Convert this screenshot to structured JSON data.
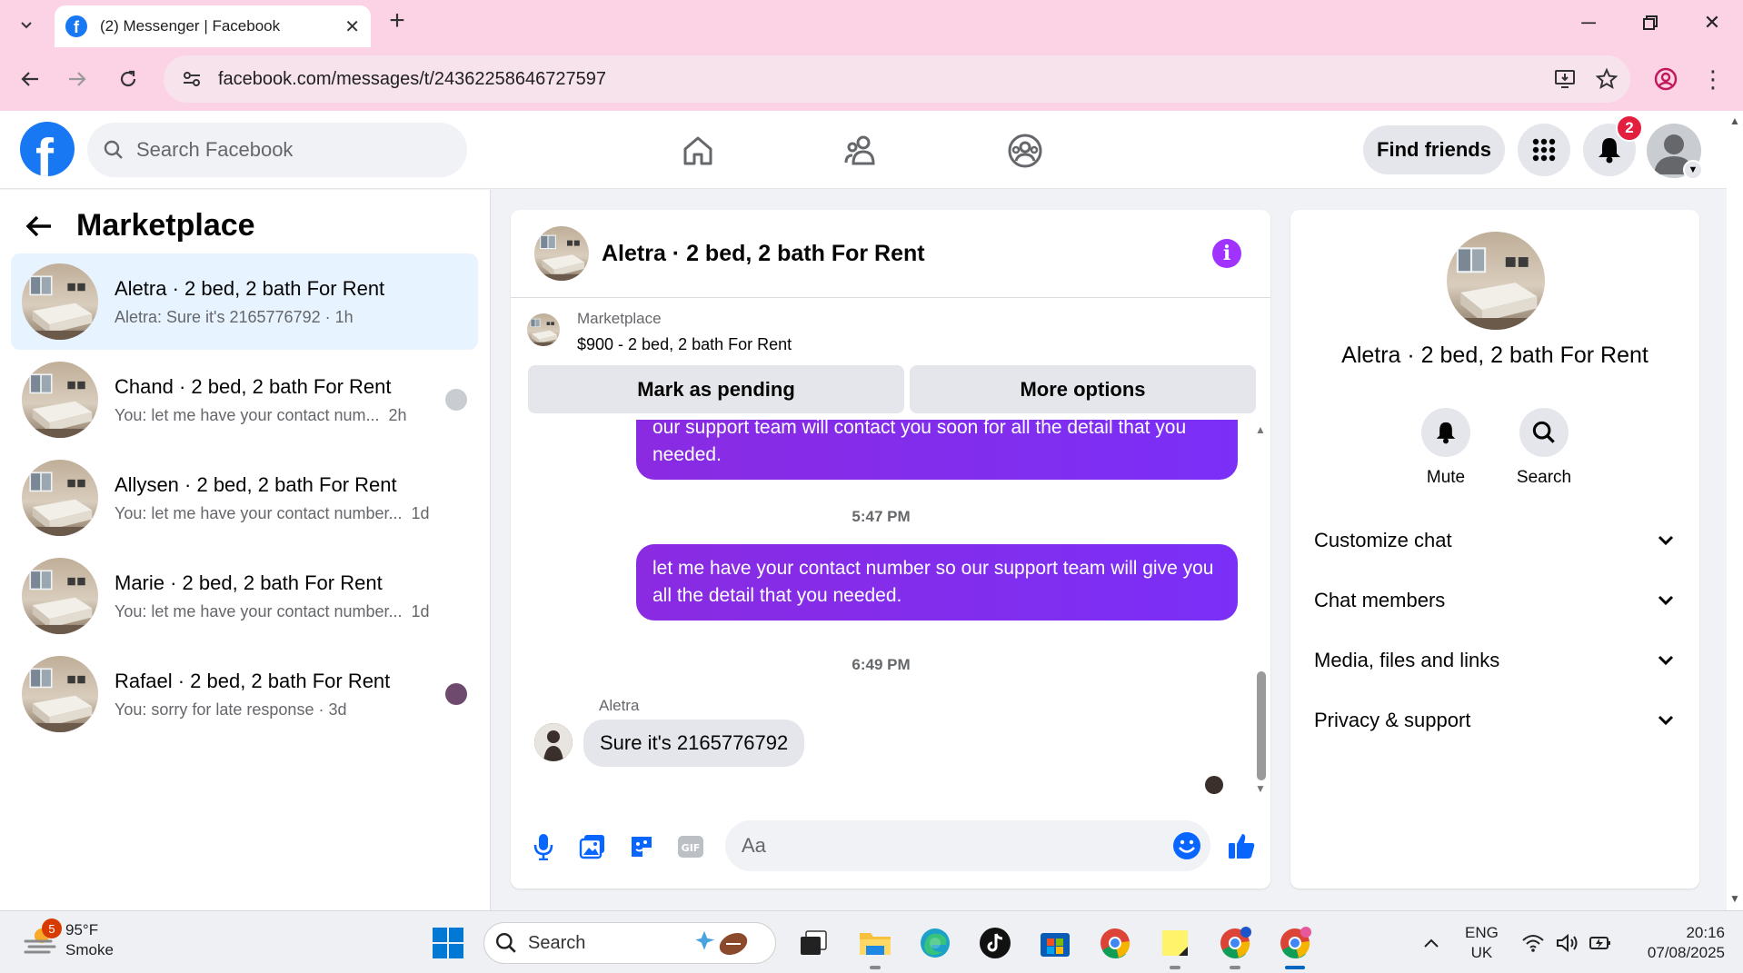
{
  "browser": {
    "tab_title": "(2) Messenger | Facebook",
    "url": "facebook.com/messages/t/24362258646727597"
  },
  "facebook": {
    "search_placeholder": "Search Facebook",
    "find_friends": "Find friends",
    "notification_count": "2"
  },
  "sidebar": {
    "title": "Marketplace",
    "conversations": [
      {
        "name": "Aletra · 2 bed, 2 bath For Rent",
        "preview": "Aletra: Sure it's 2165776792 · 1h",
        "active": true
      },
      {
        "name": "Chand · 2 bed, 2 bath For Rent",
        "preview": "You: let me have your contact num...",
        "time": "2h"
      },
      {
        "name": "Allysen · 2 bed, 2 bath For Rent",
        "preview": "You: let me have your contact number...",
        "time": "1d"
      },
      {
        "name": "Marie · 2 bed, 2 bath For Rent",
        "preview": "You: let me have your contact number...",
        "time": "1d"
      },
      {
        "name": "Rafael · 2 bed, 2 bath For Rent",
        "preview": "You: sorry for late response · 3d"
      }
    ]
  },
  "chat": {
    "title": "Aletra · 2 bed, 2 bath For Rent",
    "marketplace_label": "Marketplace",
    "listing": "$900 - 2 bed, 2 bath For Rent",
    "mark_pending": "Mark as pending",
    "more_options": "More options",
    "messages": [
      {
        "type": "out",
        "text": "our support team will contact you soon for all the detail that you needed."
      },
      {
        "type": "time",
        "text": "5:47 PM"
      },
      {
        "type": "out",
        "text": "let me have your contact number so our support team will give you all the detail that you needed."
      },
      {
        "type": "time",
        "text": "6:49 PM"
      },
      {
        "type": "sender",
        "text": "Aletra"
      },
      {
        "type": "in",
        "text": "Sure it's 2165776792"
      }
    ],
    "input_placeholder": "Aa"
  },
  "info_panel": {
    "name": "Aletra · 2 bed, 2 bath For Rent",
    "actions": [
      {
        "label": "Mute"
      },
      {
        "label": "Search"
      }
    ],
    "sections": [
      "Customize chat",
      "Chat members",
      "Media, files and links",
      "Privacy & support"
    ]
  },
  "taskbar": {
    "weather_badge": "5",
    "temperature": "95°F",
    "condition": "Smoke",
    "search_placeholder": "Search",
    "language": "ENG",
    "region": "UK",
    "time": "20:16",
    "date": "07/08/2025"
  },
  "colors": {
    "fb_blue": "#1877f2",
    "messenger_purple": "#7b2ff7",
    "tab_bar": "#fbd3e5"
  }
}
